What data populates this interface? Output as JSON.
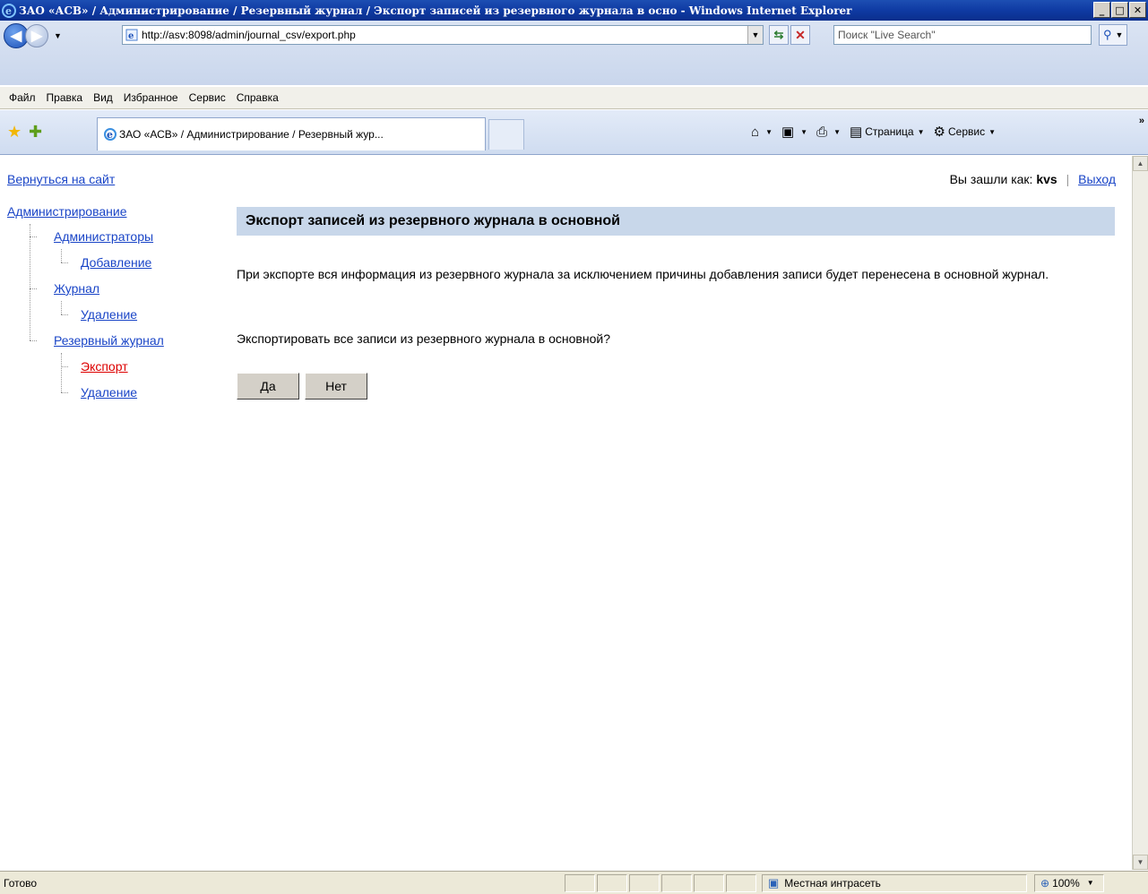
{
  "window": {
    "title": "ЗАО «АСВ» / Администрирование / Резервный журнал / Экспорт записей из резервного журнала в осно - Windows Internet Explorer"
  },
  "address_bar": {
    "url": "http://asv:8098/admin/journal_csv/export.php",
    "search_placeholder": "Поиск \"Live Search\""
  },
  "menu": {
    "items": [
      "Файл",
      "Правка",
      "Вид",
      "Избранное",
      "Сервис",
      "Справка"
    ]
  },
  "tabs": {
    "active_tab_title": "ЗАО «АСВ» / Администрирование / Резервный жур..."
  },
  "command_bar": {
    "page_label": "Страница",
    "tools_label": "Сервис"
  },
  "page": {
    "back_link": "Вернуться на сайт",
    "logged_in_label": "Вы зашли как:",
    "username": "kvs",
    "logout": "Выход",
    "tree": {
      "root": "Администрирование",
      "admins": "Администраторы",
      "add": "Добавление",
      "journal": "Журнал",
      "journal_delete": "Удаление",
      "reserve_journal": "Резервный журнал",
      "export": "Экспорт",
      "reserve_delete": "Удаление"
    },
    "heading": "Экспорт записей из резервного журнала в основной",
    "description": "При экспорте вся информация из резервного журнала за исключением причины добавления записи будет перенесена в основной журнал.",
    "question": "Экспортировать все записи из резервного журнала в основной?",
    "yes_button": "Да",
    "no_button": "Нет"
  },
  "status_bar": {
    "status": "Готово",
    "zone": "Местная интрасеть",
    "zoom": "100%"
  }
}
